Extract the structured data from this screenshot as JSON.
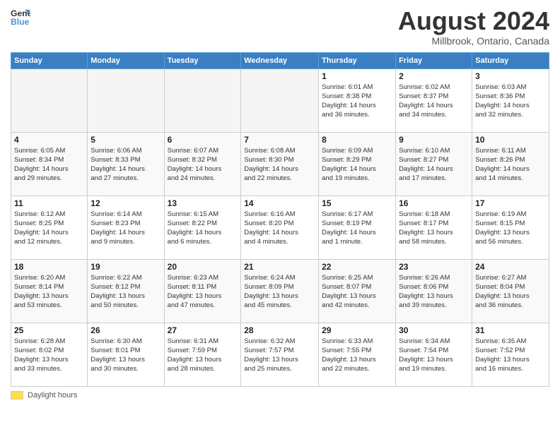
{
  "header": {
    "logo_line1": "General",
    "logo_line2": "Blue",
    "month": "August 2024",
    "location": "Millbrook, Ontario, Canada"
  },
  "weekdays": [
    "Sunday",
    "Monday",
    "Tuesday",
    "Wednesday",
    "Thursday",
    "Friday",
    "Saturday"
  ],
  "legend": {
    "label": "Daylight hours"
  },
  "weeks": [
    [
      {
        "day": "",
        "detail": ""
      },
      {
        "day": "",
        "detail": ""
      },
      {
        "day": "",
        "detail": ""
      },
      {
        "day": "",
        "detail": ""
      },
      {
        "day": "1",
        "detail": "Sunrise: 6:01 AM\nSunset: 8:38 PM\nDaylight: 14 hours\nand 36 minutes."
      },
      {
        "day": "2",
        "detail": "Sunrise: 6:02 AM\nSunset: 8:37 PM\nDaylight: 14 hours\nand 34 minutes."
      },
      {
        "day": "3",
        "detail": "Sunrise: 6:03 AM\nSunset: 8:36 PM\nDaylight: 14 hours\nand 32 minutes."
      }
    ],
    [
      {
        "day": "4",
        "detail": "Sunrise: 6:05 AM\nSunset: 8:34 PM\nDaylight: 14 hours\nand 29 minutes."
      },
      {
        "day": "5",
        "detail": "Sunrise: 6:06 AM\nSunset: 8:33 PM\nDaylight: 14 hours\nand 27 minutes."
      },
      {
        "day": "6",
        "detail": "Sunrise: 6:07 AM\nSunset: 8:32 PM\nDaylight: 14 hours\nand 24 minutes."
      },
      {
        "day": "7",
        "detail": "Sunrise: 6:08 AM\nSunset: 8:30 PM\nDaylight: 14 hours\nand 22 minutes."
      },
      {
        "day": "8",
        "detail": "Sunrise: 6:09 AM\nSunset: 8:29 PM\nDaylight: 14 hours\nand 19 minutes."
      },
      {
        "day": "9",
        "detail": "Sunrise: 6:10 AM\nSunset: 8:27 PM\nDaylight: 14 hours\nand 17 minutes."
      },
      {
        "day": "10",
        "detail": "Sunrise: 6:11 AM\nSunset: 8:26 PM\nDaylight: 14 hours\nand 14 minutes."
      }
    ],
    [
      {
        "day": "11",
        "detail": "Sunrise: 6:12 AM\nSunset: 8:25 PM\nDaylight: 14 hours\nand 12 minutes."
      },
      {
        "day": "12",
        "detail": "Sunrise: 6:14 AM\nSunset: 8:23 PM\nDaylight: 14 hours\nand 9 minutes."
      },
      {
        "day": "13",
        "detail": "Sunrise: 6:15 AM\nSunset: 8:22 PM\nDaylight: 14 hours\nand 6 minutes."
      },
      {
        "day": "14",
        "detail": "Sunrise: 6:16 AM\nSunset: 8:20 PM\nDaylight: 14 hours\nand 4 minutes."
      },
      {
        "day": "15",
        "detail": "Sunrise: 6:17 AM\nSunset: 8:19 PM\nDaylight: 14 hours\nand 1 minute."
      },
      {
        "day": "16",
        "detail": "Sunrise: 6:18 AM\nSunset: 8:17 PM\nDaylight: 13 hours\nand 58 minutes."
      },
      {
        "day": "17",
        "detail": "Sunrise: 6:19 AM\nSunset: 8:15 PM\nDaylight: 13 hours\nand 56 minutes."
      }
    ],
    [
      {
        "day": "18",
        "detail": "Sunrise: 6:20 AM\nSunset: 8:14 PM\nDaylight: 13 hours\nand 53 minutes."
      },
      {
        "day": "19",
        "detail": "Sunrise: 6:22 AM\nSunset: 8:12 PM\nDaylight: 13 hours\nand 50 minutes."
      },
      {
        "day": "20",
        "detail": "Sunrise: 6:23 AM\nSunset: 8:11 PM\nDaylight: 13 hours\nand 47 minutes."
      },
      {
        "day": "21",
        "detail": "Sunrise: 6:24 AM\nSunset: 8:09 PM\nDaylight: 13 hours\nand 45 minutes."
      },
      {
        "day": "22",
        "detail": "Sunrise: 6:25 AM\nSunset: 8:07 PM\nDaylight: 13 hours\nand 42 minutes."
      },
      {
        "day": "23",
        "detail": "Sunrise: 6:26 AM\nSunset: 8:06 PM\nDaylight: 13 hours\nand 39 minutes."
      },
      {
        "day": "24",
        "detail": "Sunrise: 6:27 AM\nSunset: 8:04 PM\nDaylight: 13 hours\nand 36 minutes."
      }
    ],
    [
      {
        "day": "25",
        "detail": "Sunrise: 6:28 AM\nSunset: 8:02 PM\nDaylight: 13 hours\nand 33 minutes."
      },
      {
        "day": "26",
        "detail": "Sunrise: 6:30 AM\nSunset: 8:01 PM\nDaylight: 13 hours\nand 30 minutes."
      },
      {
        "day": "27",
        "detail": "Sunrise: 6:31 AM\nSunset: 7:59 PM\nDaylight: 13 hours\nand 28 minutes."
      },
      {
        "day": "28",
        "detail": "Sunrise: 6:32 AM\nSunset: 7:57 PM\nDaylight: 13 hours\nand 25 minutes."
      },
      {
        "day": "29",
        "detail": "Sunrise: 6:33 AM\nSunset: 7:55 PM\nDaylight: 13 hours\nand 22 minutes."
      },
      {
        "day": "30",
        "detail": "Sunrise: 6:34 AM\nSunset: 7:54 PM\nDaylight: 13 hours\nand 19 minutes."
      },
      {
        "day": "31",
        "detail": "Sunrise: 6:35 AM\nSunset: 7:52 PM\nDaylight: 13 hours\nand 16 minutes."
      }
    ]
  ]
}
